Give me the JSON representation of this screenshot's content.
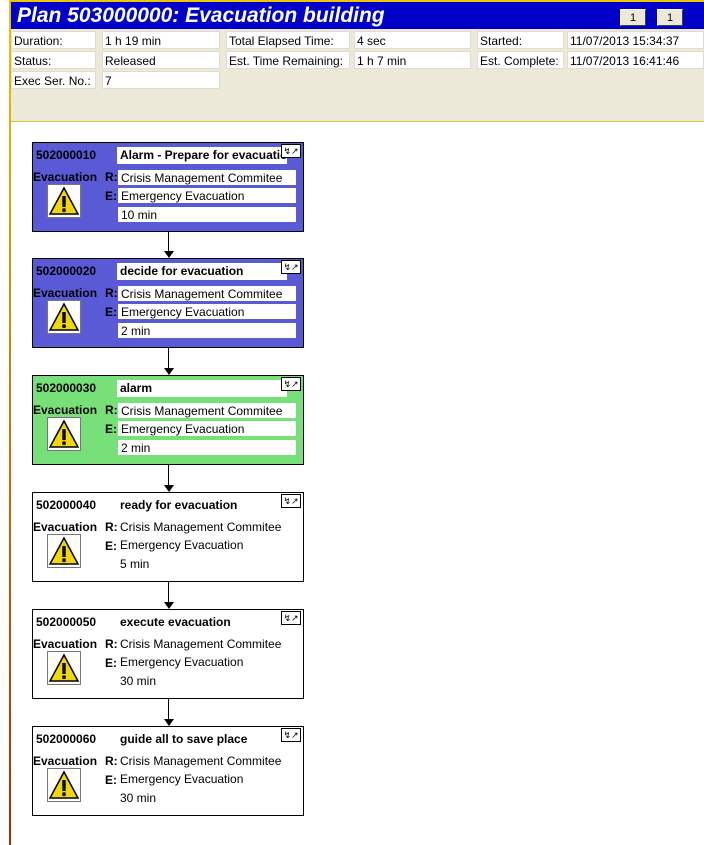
{
  "plan": {
    "title": "Plan 503000000: Evacuation building",
    "page_current": "1",
    "page_total": "1"
  },
  "info": {
    "duration_label": "Duration:",
    "duration_value": "1 h 19 min",
    "status_label": "Status:",
    "status_value": "Released",
    "exec_label": "Exec Ser. No.:",
    "exec_value": "7",
    "elapsed_label": "Total Elapsed Time:",
    "elapsed_value": "4 sec",
    "remaining_label": "Est. Time Remaining:",
    "remaining_value": "1 h 7 min",
    "started_label": "Started:",
    "started_value": "11/07/2013  15:34:37",
    "complete_label": "Est. Complete:",
    "complete_value": "11/07/2013  16:41:46"
  },
  "tasks": [
    {
      "id": "502000010",
      "name": "Alarm - Prepare for evacuation",
      "category": "Evacuation",
      "r_label": "R:",
      "r": "Crisis Management Commitee",
      "e_label": "E:",
      "e": "Emergency Evacuation",
      "duration": "10 min",
      "state": "blue"
    },
    {
      "id": "502000020",
      "name": "decide for evacuation",
      "category": "Evacuation",
      "r_label": "R:",
      "r": "Crisis Management Commitee",
      "e_label": "E:",
      "e": "Emergency Evacuation",
      "duration": "2 min",
      "state": "blue"
    },
    {
      "id": "502000030",
      "name": "alarm",
      "category": "Evacuation",
      "r_label": "R:",
      "r": "Crisis Management Commitee",
      "e_label": "E:",
      "e": "Emergency Evacuation",
      "duration": "2 min",
      "state": "green"
    },
    {
      "id": "502000040",
      "name": "ready for evacuation",
      "category": "Evacuation",
      "r_label": "R:",
      "r": "Crisis Management Commitee",
      "e_label": "E:",
      "e": "Emergency Evacuation",
      "duration": "5 min",
      "state": "white"
    },
    {
      "id": "502000050",
      "name": "execute evacuation",
      "category": "Evacuation",
      "r_label": "R:",
      "r": "Crisis Management Commitee",
      "e_label": "E:",
      "e": "Emergency Evacuation",
      "duration": "30 min",
      "state": "white"
    },
    {
      "id": "502000060",
      "name": "guide all to save place",
      "category": "Evacuation",
      "r_label": "R:",
      "r": "Crisis Management Commitee",
      "e_label": "E:",
      "e": "Emergency Evacuation",
      "duration": "30 min",
      "state": "white"
    }
  ],
  "colors": {
    "title_bar": "#0000c8",
    "state_blue": "#5a5ad6",
    "state_green": "#78e078",
    "state_white": "#ffffff",
    "warning_icon": "#f0d800"
  }
}
